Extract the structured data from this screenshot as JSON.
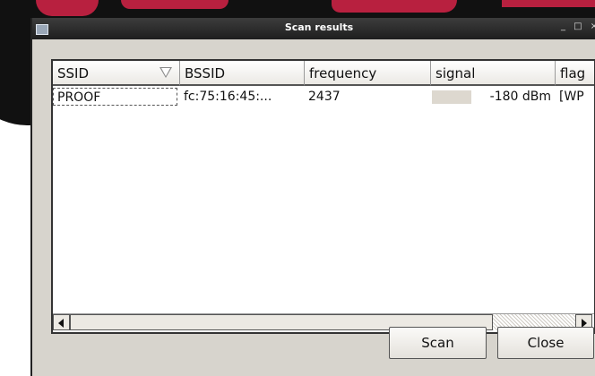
{
  "window": {
    "title": "Scan results",
    "controls": "_ □ ×"
  },
  "table": {
    "columns": [
      {
        "label": "SSID",
        "sorted": true
      },
      {
        "label": "BSSID"
      },
      {
        "label": "frequency"
      },
      {
        "label": "signal"
      },
      {
        "label": "flag"
      }
    ],
    "rows": [
      {
        "ssid": "PROOF",
        "bssid": "fc:75:16:45:...",
        "frequency": "2437",
        "signal": "-180 dBm",
        "flags": "[WP"
      }
    ]
  },
  "buttons": {
    "scan": "Scan",
    "close": "Close"
  },
  "icons": [
    "window-icon",
    "sort-icon",
    "scroll-left-icon",
    "scroll-right-icon"
  ]
}
